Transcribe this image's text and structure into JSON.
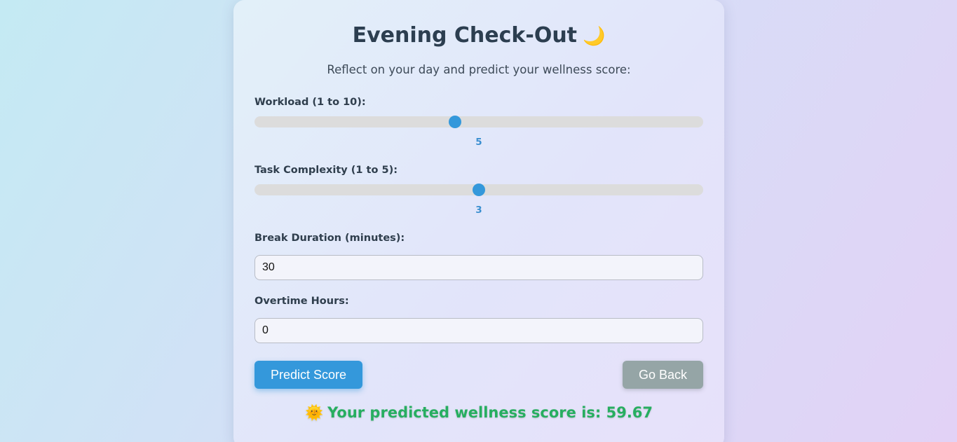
{
  "header": {
    "title": "Evening Check-Out",
    "title_icon": "🌙",
    "subtitle": "Reflect on your day and predict your wellness score:"
  },
  "form": {
    "workload": {
      "label": "Workload (1 to 10):",
      "value": "5",
      "min": 1,
      "max": 10
    },
    "complexity": {
      "label": "Task Complexity (1 to 5):",
      "value": "3",
      "min": 1,
      "max": 5
    },
    "break_duration": {
      "label": "Break Duration (minutes):",
      "value": "30"
    },
    "overtime": {
      "label": "Overtime Hours:",
      "value": "0"
    }
  },
  "actions": {
    "predict_label": "Predict Score",
    "back_label": "Go Back"
  },
  "result": {
    "icon": "🌞",
    "text": "Your predicted wellness score is: 59.67"
  },
  "colors": {
    "accent": "#3498db",
    "secondary_button": "#95a5a6",
    "result": "#27ae60",
    "title": "#2c3e50"
  }
}
